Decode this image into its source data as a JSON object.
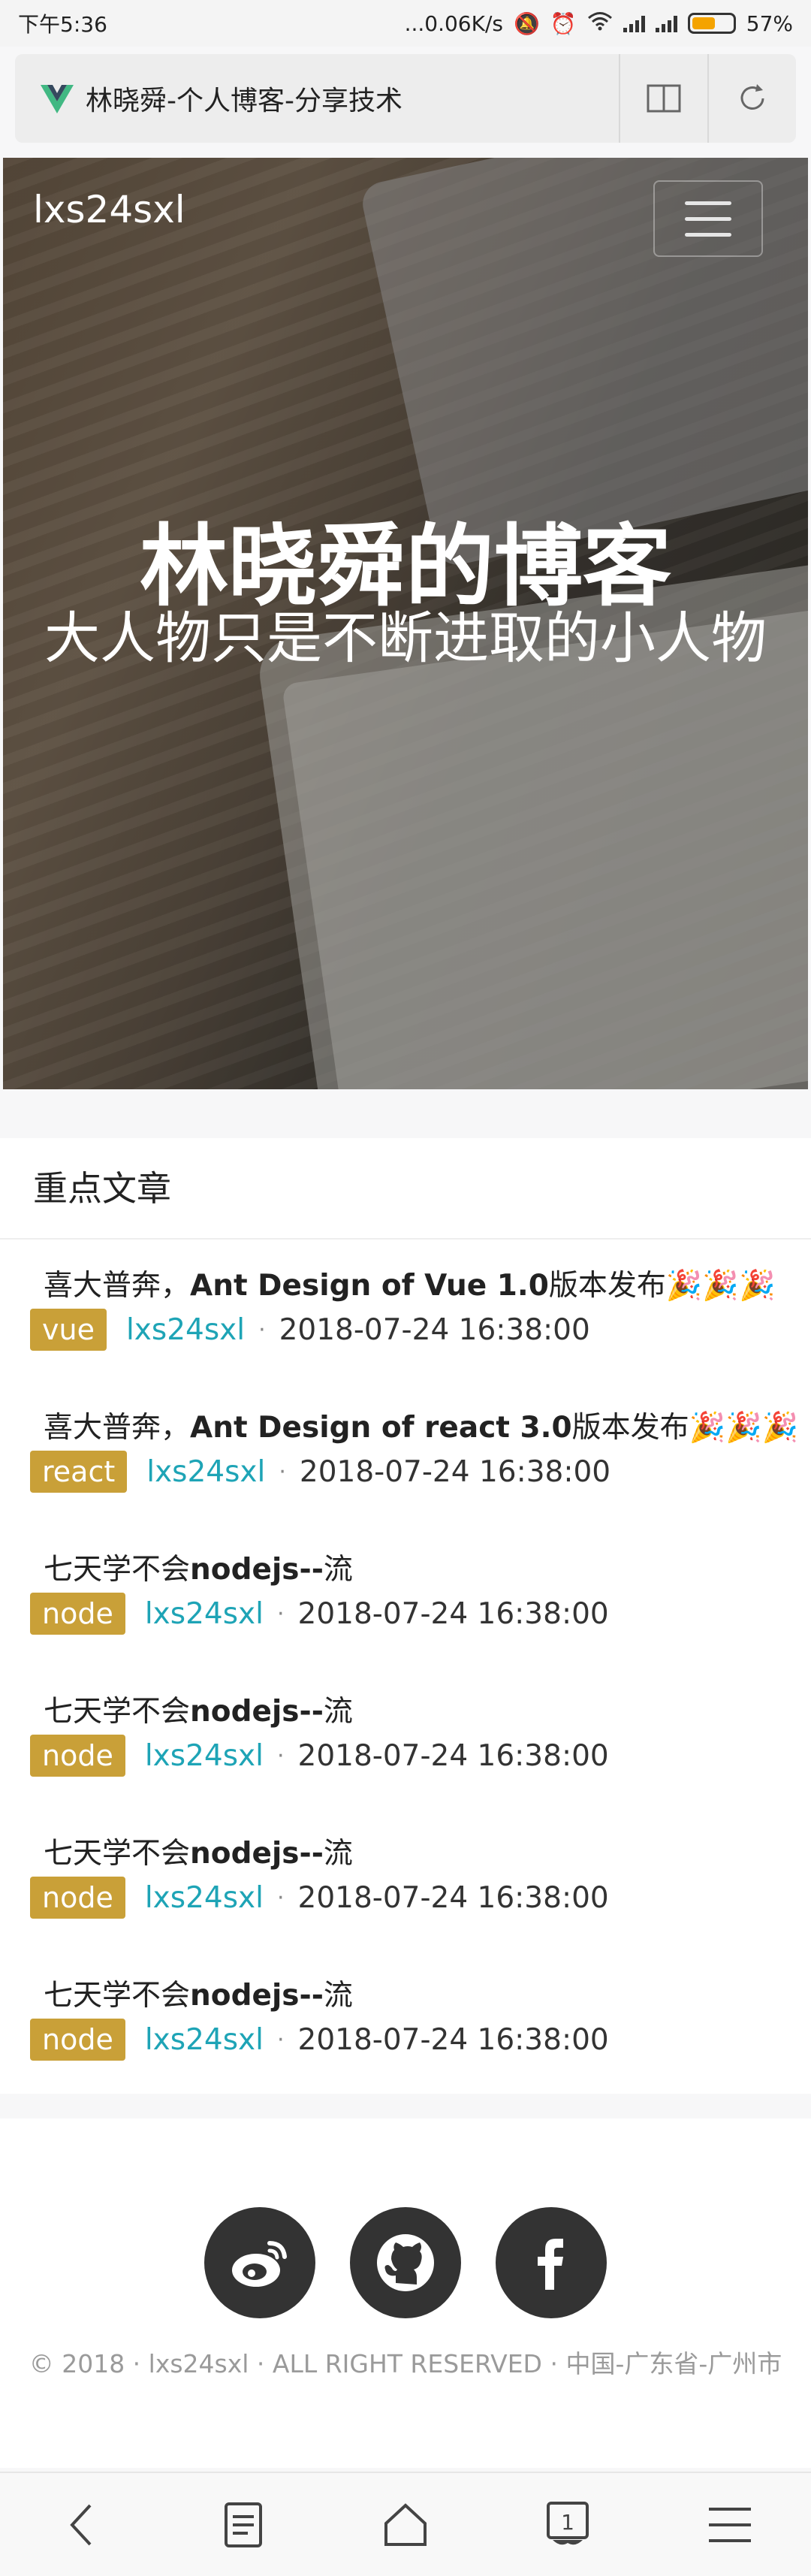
{
  "statusbar": {
    "time": "下午5:36",
    "net_speed": "...0.06K/s",
    "battery_percent": "57%",
    "battery_level": 0.57
  },
  "browser": {
    "page_title": "林晓舜-个人博客-分享技术"
  },
  "hero": {
    "brand": "lxs24sxl",
    "headline": "林晓舜的博客",
    "subline": "大人物只是不断进取的小人物"
  },
  "featured": {
    "section_title": "重点文章",
    "articles": [
      {
        "prefix": "喜大普奔，",
        "bold": "Ant Design of Vue 1.0",
        "suffix": "版本发布🎉🎉🎉",
        "tag": "vue",
        "author": "lxs24sxl",
        "date": "2018-07-24 16:38:00"
      },
      {
        "prefix": "喜大普奔，",
        "bold": "Ant Design of react 3.0",
        "suffix": "版本发布🎉🎉🎉",
        "tag": "react",
        "author": "lxs24sxl",
        "date": "2018-07-24 16:38:00"
      },
      {
        "prefix": "七天学不会",
        "bold": "nodejs--",
        "suffix": "流",
        "tag": "node",
        "author": "lxs24sxl",
        "date": "2018-07-24 16:38:00"
      },
      {
        "prefix": "七天学不会",
        "bold": "nodejs--",
        "suffix": "流",
        "tag": "node",
        "author": "lxs24sxl",
        "date": "2018-07-24 16:38:00"
      },
      {
        "prefix": "七天学不会",
        "bold": "nodejs--",
        "suffix": "流",
        "tag": "node",
        "author": "lxs24sxl",
        "date": "2018-07-24 16:38:00"
      },
      {
        "prefix": "七天学不会",
        "bold": "nodejs--",
        "suffix": "流",
        "tag": "node",
        "author": "lxs24sxl",
        "date": "2018-07-24 16:38:00"
      }
    ]
  },
  "footer": {
    "socials": [
      "weibo-icon",
      "github-icon",
      "facebook-icon"
    ],
    "copyright": "© 2018 · lxs24sxl · ALL RIGHT RESERVED · 中国-广东省-广州市"
  },
  "bottom_nav": {
    "tabs_count": "1"
  },
  "colors": {
    "tag_bg": "#c9a038",
    "author": "#1ea4b6",
    "vue_green": "#41b883"
  }
}
